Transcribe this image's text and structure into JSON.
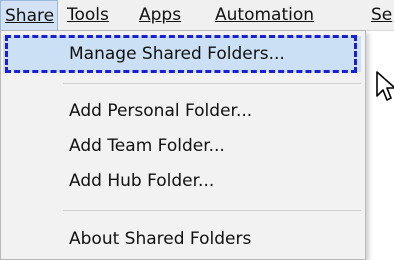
{
  "menubar": {
    "items": [
      {
        "label": "Share",
        "active": true
      },
      {
        "label": "Tools"
      },
      {
        "label": "Apps"
      },
      {
        "label": "Automation"
      },
      {
        "label": "Se"
      }
    ]
  },
  "dropdown": {
    "items": [
      {
        "label": "Manage Shared Folders...",
        "highlighted": true
      },
      {
        "label": "Add Personal Folder..."
      },
      {
        "label": "Add Team Folder..."
      },
      {
        "label": "Add Hub Folder..."
      },
      {
        "label": "About Shared Folders"
      }
    ]
  },
  "colors": {
    "highlight_border": "#1a1fd4",
    "highlight_fill": "#cce0f5"
  },
  "cursor": {
    "icon": "mouse-pointer-icon"
  }
}
